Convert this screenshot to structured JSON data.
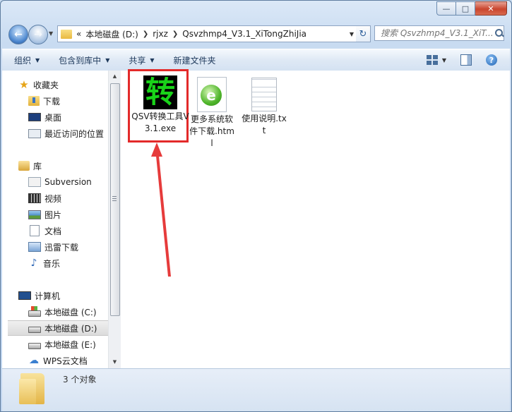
{
  "window": {
    "controls": {
      "minimize": "—",
      "maximize": "□",
      "close": "✕"
    }
  },
  "address": {
    "overflow": "«",
    "crumbs": [
      "本地磁盘 (D:)",
      "rjxz",
      "Qsvzhmp4_V3.1_XiTongZhiJia"
    ]
  },
  "search": {
    "placeholder": "搜索 Qsvzhmp4_V3.1_XiT..."
  },
  "toolbar": {
    "organize": "组织",
    "include": "包含到库中",
    "share": "共享",
    "new_folder": "新建文件夹",
    "help": "?"
  },
  "sidebar": {
    "items": [
      {
        "label": "收藏夹",
        "icon": "star-icon"
      },
      {
        "label": "下载",
        "icon": "download-folder-icon"
      },
      {
        "label": "桌面",
        "icon": "desktop-icon"
      },
      {
        "label": "最近访问的位置",
        "icon": "recent-places-icon"
      },
      {
        "label": "库",
        "icon": "library-icon"
      },
      {
        "label": "Subversion",
        "icon": "subversion-icon"
      },
      {
        "label": "视频",
        "icon": "video-icon"
      },
      {
        "label": "图片",
        "icon": "pictures-icon"
      },
      {
        "label": "文档",
        "icon": "documents-icon"
      },
      {
        "label": "迅雷下载",
        "icon": "thunder-download-icon"
      },
      {
        "label": "音乐",
        "icon": "music-icon"
      },
      {
        "label": "计算机",
        "icon": "computer-icon"
      },
      {
        "label": "本地磁盘 (C:)",
        "icon": "system-drive-icon"
      },
      {
        "label": "本地磁盘 (D:)",
        "icon": "drive-icon"
      },
      {
        "label": "本地磁盘 (E:)",
        "icon": "drive-icon"
      },
      {
        "label": "WPS云文档",
        "icon": "cloud-icon"
      }
    ],
    "selected": "本地磁盘 (D:)"
  },
  "files": [
    {
      "label": "QSV转换工具V3.1.exe",
      "icon": "exe-icon",
      "icon_glyph": "转"
    },
    {
      "label": "更多系统软件下载.html",
      "icon": "html-icon",
      "icon_glyph": "e"
    },
    {
      "label": "使用说明.txt",
      "icon": "txt-icon"
    }
  ],
  "status": {
    "count": "3 个对象"
  },
  "colors": {
    "highlight_box": "#e32a2a",
    "arrow": "#e63b3b",
    "exe_icon_fg": "#19d319"
  }
}
